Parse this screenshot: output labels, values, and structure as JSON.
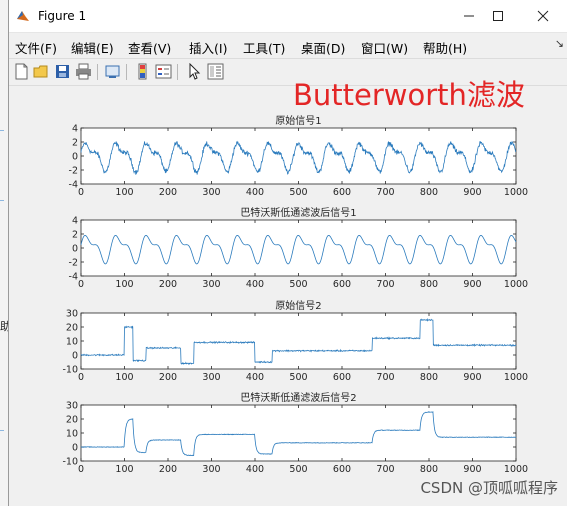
{
  "window": {
    "title": "Figure 1"
  },
  "menu": [
    {
      "label": "文件(F)"
    },
    {
      "label": "编辑(E)"
    },
    {
      "label": "查看(V)"
    },
    {
      "label": "插入(I)"
    },
    {
      "label": "工具(T)"
    },
    {
      "label": "桌面(D)"
    },
    {
      "label": "窗口(W)"
    },
    {
      "label": "帮助(H)"
    }
  ],
  "toolbar_icons": [
    "new-figure-icon",
    "open-file-icon",
    "save-icon",
    "print-icon",
    "link-plot-icon",
    "insert-colorbar-icon",
    "insert-legend-icon",
    "select-pointer-icon",
    "property-editor-icon"
  ],
  "overlay_title": "Butterworth滤波",
  "watermark": "CSDN @顶呱呱程序",
  "background_fragment": "助",
  "colors": {
    "line": "#2b7bbd",
    "overlay": "#e32626",
    "window_bg": "#f0f0f0",
    "axes_bg": "#ffffff"
  },
  "chart_data": [
    {
      "type": "line",
      "title": "原始信号1",
      "xlim": [
        0,
        1000
      ],
      "ylim": [
        -4,
        4
      ],
      "xticks": [
        0,
        100,
        200,
        300,
        400,
        500,
        600,
        700,
        800,
        900,
        1000
      ],
      "yticks": [
        -4,
        -2,
        0,
        2,
        4
      ],
      "series": [
        {
          "kind": "noisy-oscillation",
          "period_samples": 70,
          "amplitude_range": [
            -2.5,
            2.5
          ],
          "noise": true
        }
      ]
    },
    {
      "type": "line",
      "title": "巴特沃斯低通滤波后信号1",
      "xlim": [
        0,
        1000
      ],
      "ylim": [
        -4,
        4
      ],
      "xticks": [
        0,
        100,
        200,
        300,
        400,
        500,
        600,
        700,
        800,
        900,
        1000
      ],
      "yticks": [
        -4,
        -2,
        0,
        2,
        4
      ],
      "series": [
        {
          "kind": "smooth-oscillation",
          "period_samples": 70,
          "amplitude_range": [
            -2.5,
            2.5
          ],
          "noise": false
        }
      ]
    },
    {
      "type": "line",
      "title": "原始信号2",
      "xlim": [
        0,
        1000
      ],
      "ylim": [
        -10,
        30
      ],
      "xticks": [
        0,
        100,
        200,
        300,
        400,
        500,
        600,
        700,
        800,
        900,
        1000
      ],
      "yticks": [
        -10,
        0,
        10,
        20,
        30
      ],
      "series": [
        {
          "kind": "piecewise-steps",
          "noise": true,
          "segments": [
            {
              "x0": 0,
              "x1": 100,
              "y": 0
            },
            {
              "x0": 100,
              "x1": 120,
              "y": 20
            },
            {
              "x0": 120,
              "x1": 150,
              "y": -4
            },
            {
              "x0": 150,
              "x1": 230,
              "y": 5
            },
            {
              "x0": 230,
              "x1": 260,
              "y": -6
            },
            {
              "x0": 260,
              "x1": 400,
              "y": 9
            },
            {
              "x0": 400,
              "x1": 440,
              "y": -5
            },
            {
              "x0": 440,
              "x1": 670,
              "y": 3
            },
            {
              "x0": 670,
              "x1": 780,
              "y": 12
            },
            {
              "x0": 780,
              "x1": 810,
              "y": 25
            },
            {
              "x0": 810,
              "x1": 1000,
              "y": 7
            }
          ]
        }
      ]
    },
    {
      "type": "line",
      "title": "巴特沃斯低通滤波后信号2",
      "xlim": [
        0,
        1000
      ],
      "ylim": [
        -10,
        30
      ],
      "xticks": [
        0,
        100,
        200,
        300,
        400,
        500,
        600,
        700,
        800,
        900,
        1000
      ],
      "yticks": [
        -10,
        0,
        10,
        20,
        30
      ],
      "series": [
        {
          "kind": "piecewise-steps-filtered",
          "noise": false,
          "segments": [
            {
              "x0": 0,
              "x1": 100,
              "y": 0
            },
            {
              "x0": 100,
              "x1": 120,
              "y": 20
            },
            {
              "x0": 120,
              "x1": 150,
              "y": -4
            },
            {
              "x0": 150,
              "x1": 230,
              "y": 5
            },
            {
              "x0": 230,
              "x1": 260,
              "y": -6
            },
            {
              "x0": 260,
              "x1": 400,
              "y": 9
            },
            {
              "x0": 400,
              "x1": 440,
              "y": -5
            },
            {
              "x0": 440,
              "x1": 670,
              "y": 3
            },
            {
              "x0": 670,
              "x1": 780,
              "y": 12
            },
            {
              "x0": 780,
              "x1": 810,
              "y": 25
            },
            {
              "x0": 810,
              "x1": 1000,
              "y": 7
            }
          ]
        }
      ]
    }
  ]
}
